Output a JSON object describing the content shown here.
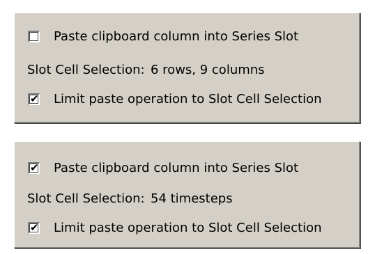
{
  "panels": [
    {
      "paste_column": {
        "label": "Paste clipboard column into Series Slot",
        "checked": false
      },
      "selection": {
        "label": "Slot Cell Selection:",
        "value": "6 rows, 9 columns"
      },
      "limit_paste": {
        "label": "Limit paste operation to Slot Cell Selection",
        "checked": true
      }
    },
    {
      "paste_column": {
        "label": "Paste clipboard column into Series Slot",
        "checked": true
      },
      "selection": {
        "label": "Slot Cell Selection:",
        "value": "54 timesteps"
      },
      "limit_paste": {
        "label": "Limit paste operation to Slot Cell Selection",
        "checked": true
      }
    }
  ],
  "check_glyph": "✔"
}
